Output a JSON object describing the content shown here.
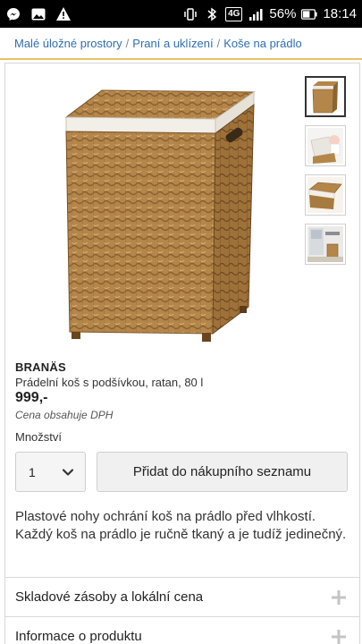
{
  "statusbar": {
    "network_badge": "4G",
    "battery_percent": "56%",
    "time": "18:14"
  },
  "breadcrumb": {
    "items": [
      {
        "label": "Malé úložné prostory"
      },
      {
        "label": "Praní a uklízení"
      },
      {
        "label": "Koše na prádlo"
      }
    ],
    "separator": "/"
  },
  "product": {
    "name": "BRANÄS",
    "description": "Prádelní koš s podšívkou, ratan, 80 l",
    "price": "999,-",
    "vat_note": "Cena obsahuje DPH",
    "quantity_label": "Množství",
    "quantity_value": "1",
    "add_button_label": "Přidat do nákupního seznamu",
    "long_description": "Plastové nohy ochrání koš na prádlo před vlhkostí. Každý koš na prádlo je ručně tkaný a je tudíž jedinečný."
  },
  "thumbnails": [
    {
      "icon": "basket-thumbnail",
      "active": true
    },
    {
      "icon": "lining-thumbnail",
      "active": false
    },
    {
      "icon": "lid-thumbnail",
      "active": false
    },
    {
      "icon": "room-thumbnail",
      "active": false
    }
  ],
  "accordions": [
    {
      "label": "Skladové zásoby a lokální cena",
      "icon": "plus-icon"
    },
    {
      "label": "Informace o produktu",
      "icon": "plus-icon"
    }
  ],
  "colors": {
    "link": "#2f6fb3",
    "accent_border": "#e8c26a",
    "wicker": "#b4864a"
  }
}
